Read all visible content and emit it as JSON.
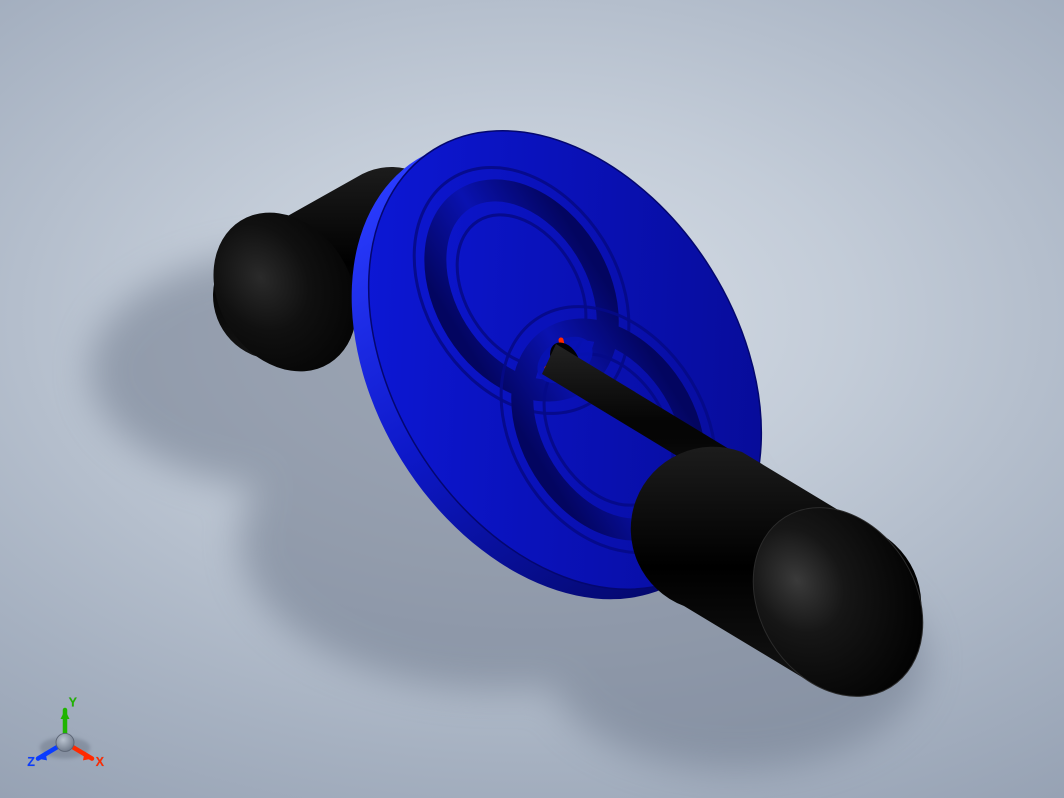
{
  "scene": {
    "background_gradient": [
      "#d6dde6",
      "#c3ccd8",
      "#a6b1c1",
      "#8c98ab",
      "#7e8a9e"
    ],
    "ground_shadow_color": "#7f8a9c"
  },
  "model": {
    "disc": {
      "color_face": "#0b14bf",
      "color_edge": "#1a2fdd",
      "feature_color_dark": "#060a8a",
      "center_origin_marker": "#ff2a00"
    },
    "axle": {
      "shaft_color": "#0a0a0a",
      "end_color_light": "#1b1b1b",
      "end_color_dark": "#000000"
    }
  },
  "triad": {
    "axes": {
      "x": {
        "label": "X",
        "color": "#ff2a00"
      },
      "y": {
        "label": "Y",
        "color": "#1fb400"
      },
      "z": {
        "label": "Z",
        "color": "#0a3cff"
      }
    },
    "hub_color": "#808a9a"
  }
}
